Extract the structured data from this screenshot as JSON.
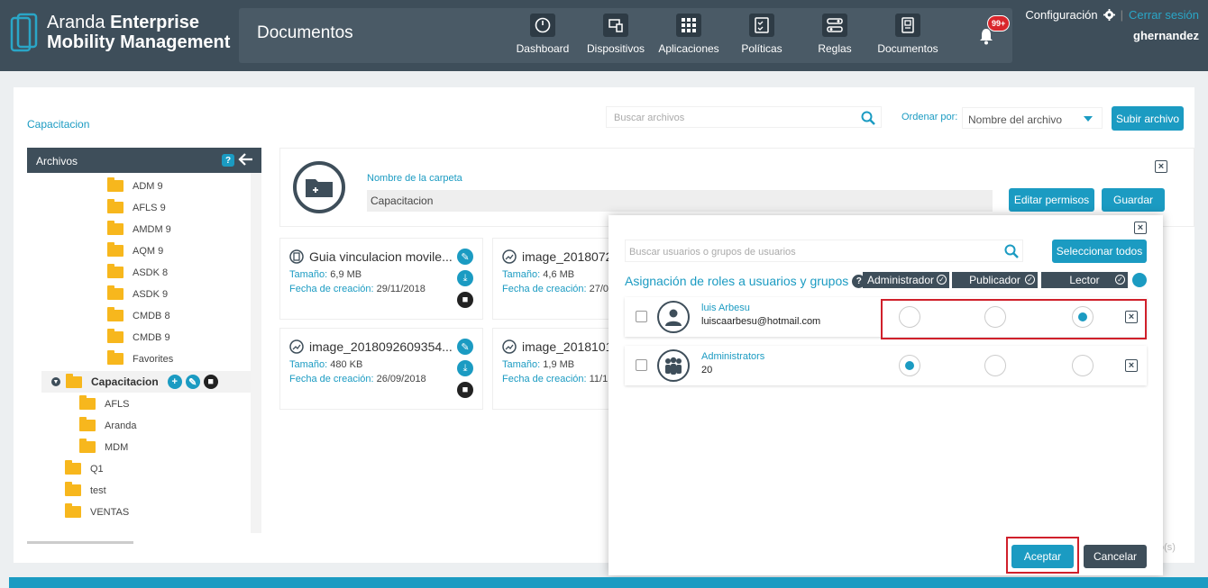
{
  "brand": {
    "light": "Aranda",
    "bold1": "Enterprise",
    "bold2": "Mobility Management"
  },
  "header": {
    "page_title": "Documentos",
    "nav": [
      {
        "label": "Dashboard",
        "icon": "dashboard-icon"
      },
      {
        "label": "Dispositivos",
        "icon": "devices-icon"
      },
      {
        "label": "Aplicaciones",
        "icon": "apps-grid-icon"
      },
      {
        "label": "Políticas",
        "icon": "policies-icon"
      },
      {
        "label": "Reglas",
        "icon": "rules-icon"
      },
      {
        "label": "Documentos",
        "icon": "documents-icon"
      }
    ],
    "notifications_badge": "99+",
    "config_label": "Configuración",
    "logout_label": "Cerrar sesión",
    "username": "ghernandez"
  },
  "toolbar": {
    "breadcrumb": "Capacitacion",
    "search_placeholder": "Buscar archivos",
    "order_label": "Ordenar por:",
    "order_value": "Nombre del archivo",
    "upload_label": "Subir archivo"
  },
  "tree": {
    "title": "Archivos",
    "help": "?",
    "items": [
      {
        "label": "ADM 9"
      },
      {
        "label": "AFLS 9"
      },
      {
        "label": "AMDM 9"
      },
      {
        "label": "AQM 9"
      },
      {
        "label": "ASDK 8"
      },
      {
        "label": "ASDK 9"
      },
      {
        "label": "CMDB 8"
      },
      {
        "label": "CMDB 9"
      },
      {
        "label": "Favorites"
      }
    ],
    "selected": "Capacitacion",
    "children": [
      {
        "label": "AFLS"
      },
      {
        "label": "Aranda"
      },
      {
        "label": "MDM"
      }
    ],
    "others": [
      {
        "label": "Q1"
      },
      {
        "label": "test"
      },
      {
        "label": "VENTAS"
      }
    ]
  },
  "folder_card": {
    "name_label": "Nombre de la carpeta",
    "name_value": "Capacitacion",
    "edit_permissions": "Editar permisos",
    "save": "Guardar"
  },
  "files": [
    {
      "name": "Guia vinculacion movile...",
      "size_label": "Tamaño:",
      "size": "6,9 MB",
      "date_label": "Fecha de creación:",
      "date": "29/11/2018"
    },
    {
      "name": "image_2018072",
      "size_label": "Tamaño:",
      "size": "4,6 MB",
      "date_label": "Fecha de creación:",
      "date": "27/0"
    },
    {
      "name": "image_2018092609354...",
      "size_label": "Tamaño:",
      "size": "480 KB",
      "date_label": "Fecha de creación:",
      "date": "26/09/2018"
    },
    {
      "name": "image_2018101",
      "size_label": "Tamaño:",
      "size": "1,9 MB",
      "date_label": "Fecha de creación:",
      "date": "11/1"
    }
  ],
  "files_count_fragment": "o(s)",
  "modal": {
    "search_placeholder": "Buscar usuarios o grupos de usuarios",
    "select_all": "Seleccionar todos",
    "roles_title": "Asignación de roles a usuarios y grupos",
    "roles": [
      "Administrador",
      "Publicador",
      "Lector"
    ],
    "rows": [
      {
        "name": "luis Arbesu",
        "sub": "luiscaarbesu@hotmail.com",
        "type": "user",
        "role_index": 2
      },
      {
        "name": "Administrators",
        "sub": "20",
        "type": "group",
        "role_index": 0
      }
    ],
    "accept": "Aceptar",
    "cancel": "Cancelar"
  },
  "colors": {
    "header": "#3e4e5a",
    "accent": "#1b9bc2",
    "folder": "#f7b71d",
    "highlight": "#d0202b"
  }
}
